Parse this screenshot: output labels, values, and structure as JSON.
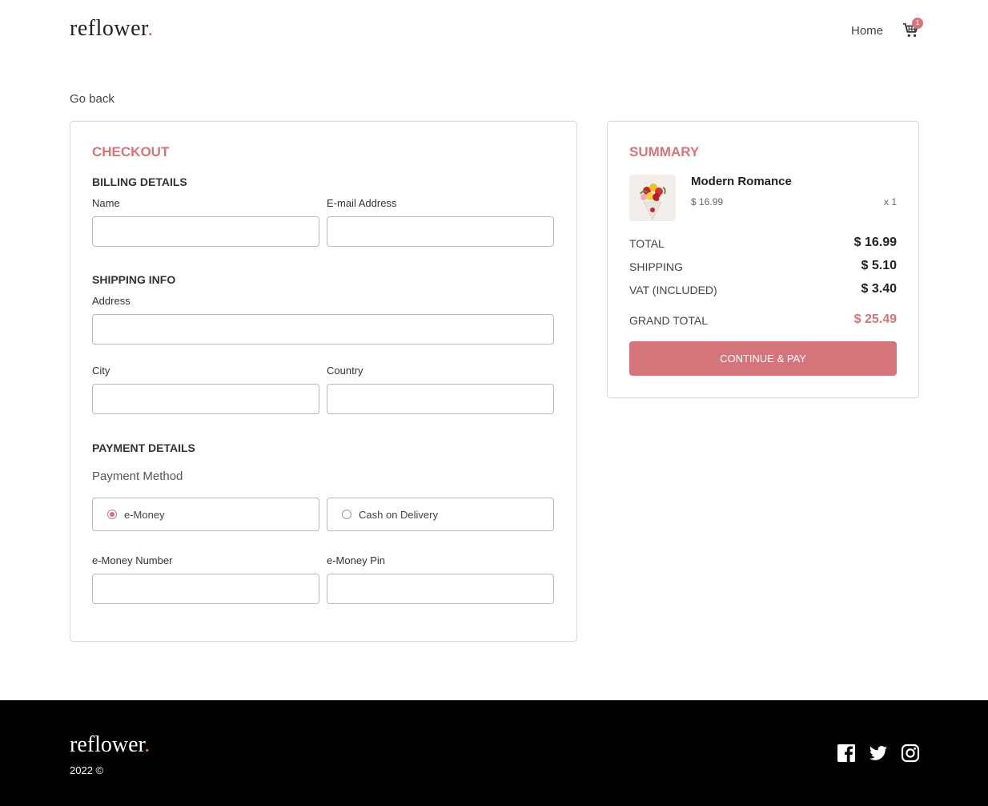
{
  "brand": {
    "name": "reflower",
    "dot": ".",
    "accent": "#d4757b"
  },
  "nav": {
    "home": "Home",
    "cart_count": "1"
  },
  "go_back": "Go back",
  "checkout": {
    "title": "CHECKOUT",
    "billing": {
      "title": "BILLING DETAILS",
      "name_label": "Name",
      "email_label": "E-mail Address"
    },
    "shipping": {
      "title": "SHIPPING INFO",
      "address_label": "Address",
      "city_label": "City",
      "country_label": "Country"
    },
    "payment": {
      "title": "PAYMENT DETAILS",
      "method_label": "Payment Method",
      "options": [
        "e-Money",
        "Cash on Delivery"
      ],
      "selected": "e-Money",
      "number_label": "e-Money Number",
      "pin_label": "e-Money Pin"
    }
  },
  "summary": {
    "title": "SUMMARY",
    "item": {
      "name": "Modern Romance",
      "price": "$ 16.99",
      "qty": "x 1"
    },
    "rows": [
      {
        "label": "TOTAL",
        "value": "$ 16.99"
      },
      {
        "label": "SHIPPING",
        "value": "$ 5.10"
      },
      {
        "label": "VAT (INCLUDED)",
        "value": "$ 3.40"
      }
    ],
    "grand": {
      "label": "GRAND TOTAL",
      "value": "$ 25.49"
    },
    "button": "CONTINUE & PAY"
  },
  "footer": {
    "copyright": "2022 ©"
  }
}
